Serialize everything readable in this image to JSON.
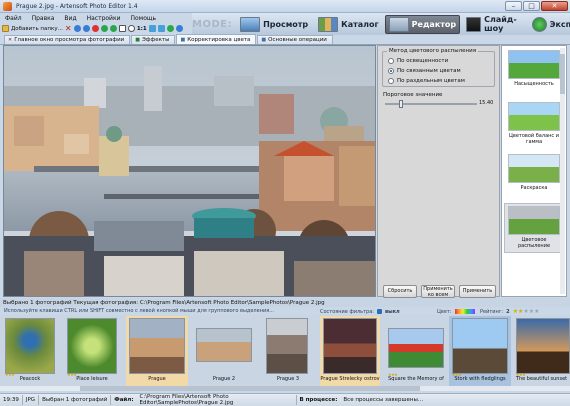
{
  "window": {
    "title": "Prague 2.jpg - Artensoft Photo Editor 1.4",
    "minimize": "–",
    "maximize": "□",
    "close": "✕"
  },
  "menu": [
    "Файл",
    "Правка",
    "Вид",
    "Настройки",
    "Помощь"
  ],
  "toolbar": {
    "add_folder_label": "Добавить папку...",
    "zoom_label": "1:1"
  },
  "modes": {
    "label": "MODE:",
    "items": [
      {
        "label": "Просмотр",
        "active": false
      },
      {
        "label": "Каталог",
        "active": false
      },
      {
        "label": "Редактор",
        "active": true
      },
      {
        "label": "Слайд-шоу",
        "active": false
      },
      {
        "label": "Экспорт",
        "active": false
      }
    ]
  },
  "subtabs": [
    {
      "label": "Главное окно просмотра фотографии",
      "active": false
    },
    {
      "label": "Эффекты",
      "active": false
    },
    {
      "label": "Корректировка цвета",
      "active": true
    },
    {
      "label": "Основные операции",
      "active": false
    }
  ],
  "settings": {
    "method_title": "Метод цветового распыления",
    "methods": [
      {
        "label": "По освещенности",
        "selected": false
      },
      {
        "label": "По связанным цветам",
        "selected": true
      },
      {
        "label": "По раздельным цветам",
        "selected": false
      }
    ],
    "threshold_label": "Пороговое значение",
    "threshold_value": "15.40",
    "threshold_fraction": 0.16,
    "buttons": {
      "reset": "Сбросить",
      "apply_all": "Применить ко всем",
      "apply": "Применить"
    }
  },
  "effects": [
    {
      "label": "Насыщенность",
      "selected": false
    },
    {
      "label": "Цветовой баланс и гамма",
      "selected": false
    },
    {
      "label": "Раскраска",
      "selected": false
    },
    {
      "label": "Цветовое распыление",
      "selected": true
    }
  ],
  "browser": {
    "header": "Выбрано 1 фотографий   Текущая фотография: C:\\Program Files\\Artensoft Photo Editor\\SamplePhotos\\Prague 2.jpg",
    "hint": "Используйте клавиши CTRL или SHIFT совместно с левой кнопкой мыши для группового выделения...",
    "filter_label": "Состояние фильтра:",
    "filter_value": "выкл",
    "color_label": "Цвет:",
    "rating_label": "Рейтинг:",
    "rating_value": 2,
    "rating_max": 5
  },
  "filmstrip": [
    {
      "label": "Peacock",
      "selected": false,
      "rating": 3
    },
    {
      "label": "Place leisure",
      "selected": false,
      "rating": 3
    },
    {
      "label": "Prague",
      "selected": true,
      "rating": 0
    },
    {
      "label": "Prague 2",
      "selected": false,
      "rating": 0
    },
    {
      "label": "Prague 3",
      "selected": false,
      "rating": 0
    },
    {
      "label": "Prague Strelecky ostrov",
      "selected": true,
      "rating": 0
    },
    {
      "label": "Square the Memory of",
      "selected": false,
      "rating": 3
    },
    {
      "label": "Stork with fledglings",
      "selected": false,
      "rating": 3
    },
    {
      "label": "The beautiful sunset",
      "selected": false,
      "rating": 3
    }
  ],
  "status": {
    "time": "19:39",
    "format": "JPG",
    "selected": "Выбран 1 фотографий",
    "file_label": "Файл:",
    "file_path": "C:\\Program Files\\Artensoft Photo Editor\\SamplePhotos\\Prague 2.jpg",
    "progress_label": "В процессе:",
    "progress_text": "Все процессы завершены..."
  }
}
